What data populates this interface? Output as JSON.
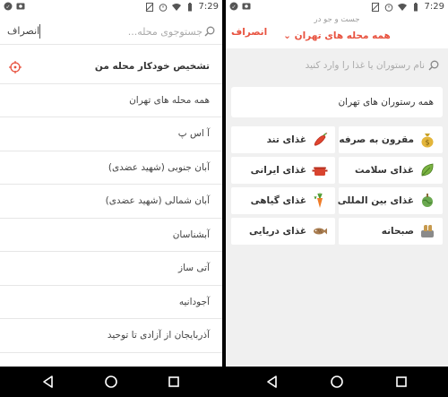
{
  "status_bar": {
    "time": "7:29"
  },
  "left_screen": {
    "cancel_label": "انصراف",
    "search_placeholder": "جستوجوی محله...",
    "neighborhoods": [
      "تشخیص خودکار محله من",
      "همه محله های تهران",
      "آ اس پ",
      "آبان جنوبی (شهید عضدی)",
      "آبان شمالی (شهید عضدی)",
      "آبشناسان",
      "آتی ساز",
      "آجودانیه",
      "آذربایجان از آزادی تا توحید"
    ]
  },
  "right_screen": {
    "subtitle": "جست و جو در",
    "location_title": "همه محله های تهران",
    "cancel_label": "انصراف",
    "search_placeholder": "نام رستوران یا غذا را وارد کنید",
    "all_restaurants_label": "همه رستوران های تهران",
    "categories": [
      {
        "label": "مقرون به صرفه",
        "icon": "money-bag-icon",
        "color": "#c9a227"
      },
      {
        "label": "غذای تند",
        "icon": "chili-pepper-icon",
        "color": "#e0452f"
      },
      {
        "label": "غذای سلامت",
        "icon": "leaf-icon",
        "color": "#7bb342"
      },
      {
        "label": "غذای ایرانی",
        "icon": "pot-icon",
        "color": "#d9442f"
      },
      {
        "label": "غذای بین المللی",
        "icon": "globe-food-icon",
        "color": "#6aa84f"
      },
      {
        "label": "غذای گیاهی",
        "icon": "carrot-icon",
        "color": "#ef7d2a"
      },
      {
        "label": "صبحانه",
        "icon": "toaster-icon",
        "color": "#c79a4e"
      },
      {
        "label": "غذای دریایی",
        "icon": "fish-icon",
        "color": "#a87c4f"
      }
    ]
  },
  "colors": {
    "accent": "#e8523f",
    "background": "#f0f0f0"
  }
}
